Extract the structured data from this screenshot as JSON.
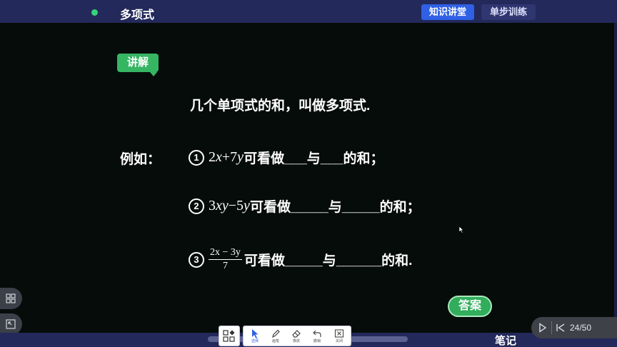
{
  "header": {
    "title": "多项式",
    "tabs": [
      {
        "label": "知识讲堂",
        "active": true
      },
      {
        "label": "单步训练",
        "active": false
      }
    ]
  },
  "board": {
    "tag": "讲解",
    "definition": "几个单项式的和，叫做多项式.",
    "example_label": "例如：",
    "items": [
      {
        "number": "1",
        "expr": "2x+7y",
        "text": "可看做___与___的和；"
      },
      {
        "number": "2",
        "expr": "3xy−5y",
        "text": "可看做_____与_____的和；"
      },
      {
        "number": "3",
        "frac_num": "2x − 3y",
        "frac_den": "7",
        "text": "可看做_____与______的和."
      }
    ],
    "answer_button": "答案"
  },
  "toolbar": {
    "tools": [
      {
        "icon": "arrow-cursor-icon",
        "label": "选择",
        "active": true
      },
      {
        "icon": "pen-icon",
        "label": "画笔",
        "active": false
      },
      {
        "icon": "eraser-icon",
        "label": "橡皮",
        "active": false
      },
      {
        "icon": "undo-icon",
        "label": "撤销",
        "active": false
      },
      {
        "icon": "close-box-icon",
        "label": "关闭",
        "active": false
      }
    ],
    "notes_label": "笔记"
  },
  "pager": {
    "current": 24,
    "total": 50,
    "display": "24/50"
  },
  "colors": {
    "board_bg": "#060c09",
    "frame_bg": "#23295a",
    "active_tab": "#2f60e6",
    "green_accent": "#36b563"
  }
}
